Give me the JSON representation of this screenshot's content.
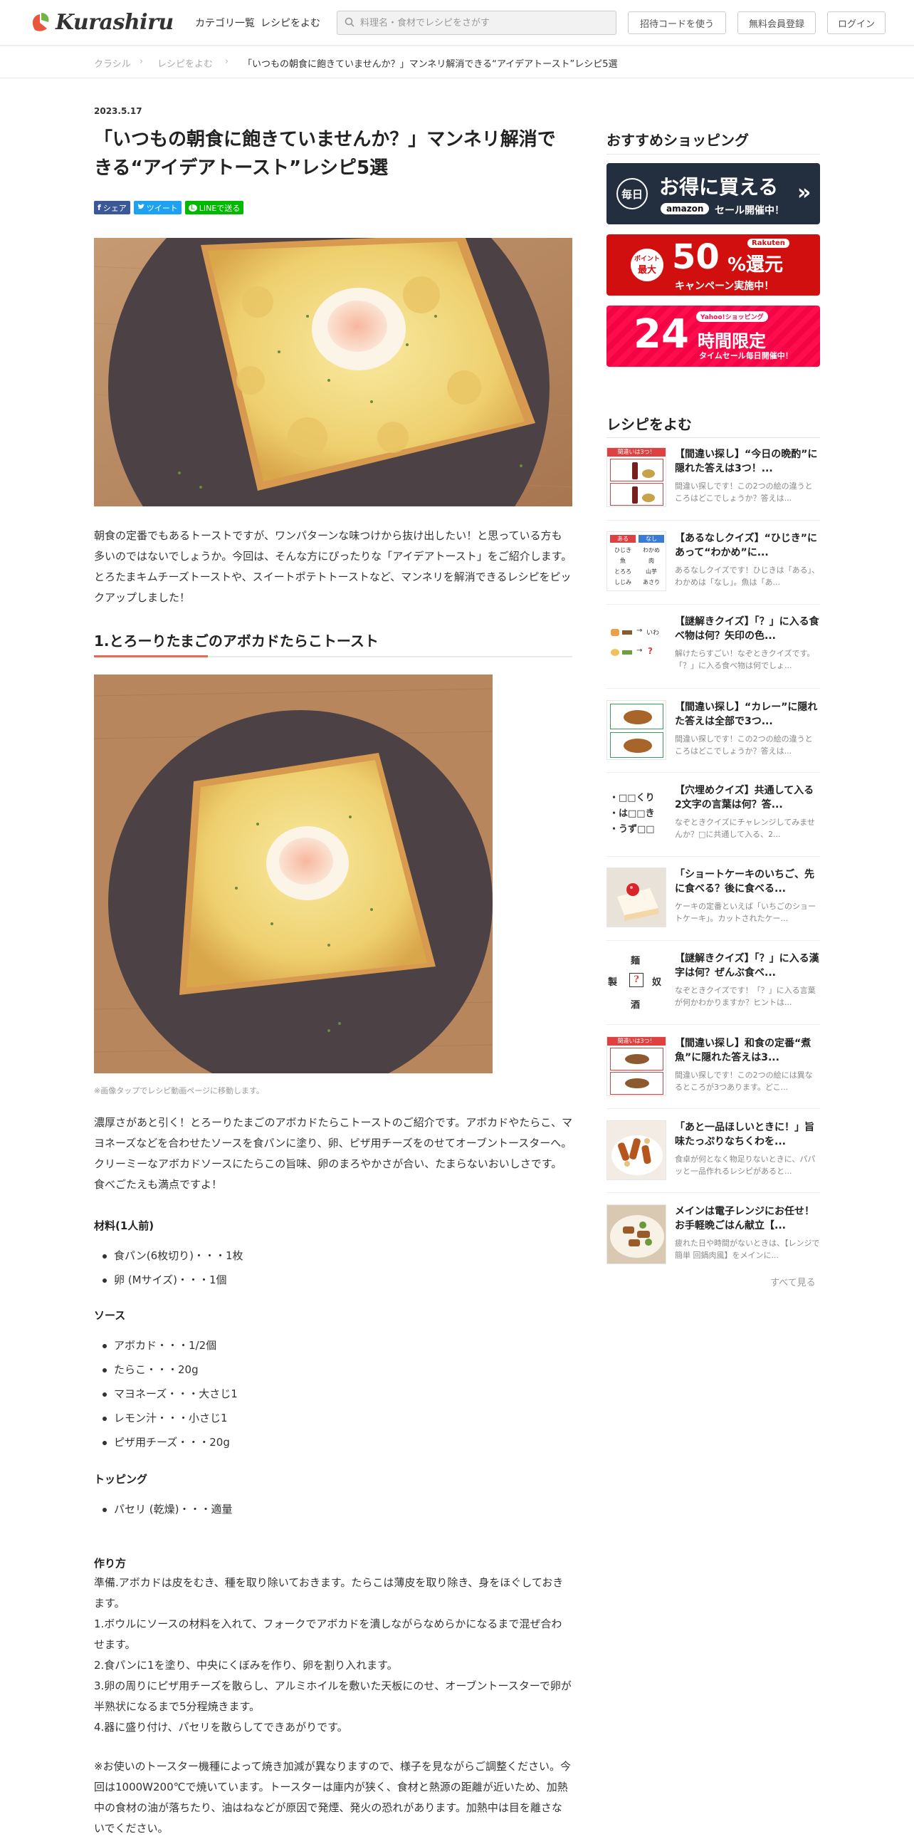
{
  "header": {
    "logo_text": "Kurashiru",
    "nav_category": "カテゴリ一覧",
    "nav_read": "レシピをよむ",
    "search_placeholder": "料理名・食材でレシピをさがす",
    "invite_button": "招待コードを使う",
    "register_button": "無料会員登録",
    "login_button": "ログイン"
  },
  "breadcrumb": {
    "items": [
      "クラシル",
      "レシピをよむ",
      "「いつもの朝食に飽きていませんか？」マンネリ解消できる“アイデアトースト”レシピ5選"
    ]
  },
  "article": {
    "date": "2023.5.17",
    "title": "「いつもの朝食に飽きていませんか？」マンネリ解消できる“アイデアトースト”レシピ5選",
    "share": {
      "facebook": "シェア",
      "twitter": "ツイート",
      "line": "LINEで送る"
    },
    "intro": "朝食の定番でもあるトーストですが、ワンパターンな味つけから抜け出したい！と思っている方も多いのではないでしょうか。今回は、そんな方にぴったりな「アイデアトースト」をご紹介します。とろたまキムチーズトーストや、スイートポテトトーストなど、マンネリを解消できるレシピをピックアップしました！",
    "section1_title": "1.とろーりたまごのアボカドたらこトースト",
    "image_caption": "※画像タップでレシピ動画ページに移動します。",
    "section1_text": "濃厚さがあと引く！とろーりたまごのアボカドたらこトーストのご紹介です。アボカドやたらこ、マヨネーズなどを合わせたソースを食パンに塗り、卵、ピザ用チーズをのせてオーブントースターへ。クリーミーなアボカドソースにたらこの旨味、卵のまろやかさが合い、たまらないおいしさです。食べごたえも満点ですよ！",
    "ingredients_title": "材料(1人前)",
    "ingredients": [
      "食パン(6枚切り)・・・1枚",
      "卵 (Mサイズ)・・・1個"
    ],
    "sauce_title": "ソース",
    "sauce": [
      "アボカド・・・1/2個",
      "たらこ・・・20g",
      "マヨネーズ・・・大さじ1",
      "レモン汁・・・小さじ1",
      "ピザ用チーズ・・・20g"
    ],
    "topping_title": "トッピング",
    "topping": [
      "パセリ (乾燥)・・・適量"
    ],
    "steps_title": "作り方",
    "steps": [
      "準備.アボカドは皮をむき、種を取り除いておきます。たらこは薄皮を取り除き、身をほぐしておきます。",
      "1.ボウルにソースの材料を入れて、フォークでアボカドを潰しながらなめらかになるまで混ぜ合わせます。",
      "2.食パンに1を塗り、中央にくぼみを作り、卵を割り入れます。",
      "3.卵の周りにピザ用チーズを散らし、アルミホイルを敷いた天板にのせ、オーブントースターで卵が半熟状になるまで5分程焼きます。",
      "4.器に盛り付け、パセリを散らしてできあがりです。"
    ],
    "note": "※お使いのトースター機種によって焼き加減が異なりますので、様子を見ながらご調整ください。今回は1000W200℃で焼いています。トースターは庫内が狭く、食材と熱源の距離が近いため、加熱中の食材の油が落ちたり、油はねなどが原因で発煙、発火の恐れがあります。加熱中は目を離さないでください。"
  },
  "sidebar": {
    "shopping_title": "おすすめショッピング",
    "banners": [
      {
        "badge": "毎日",
        "main": "お得に買える",
        "brand": "amazon",
        "sub": "セール開催中！"
      },
      {
        "badge_top": "ポイント",
        "badge_bottom": "最大",
        "num": "50",
        "unit": "%還元",
        "brand": "Rakuten",
        "sub": "キャンペーン実施中！"
      },
      {
        "brand": "Yahoo!ショッピング",
        "num": "24",
        "main": "時間限定",
        "sub": "タイムセール毎日開催中！"
      }
    ],
    "read_title": "レシピをよむ",
    "items": [
      {
        "title": "【間違い探し】“今日の晩酌”に隠れた答えは3つ！...",
        "desc": "間違い探しです！この2つの絵の違うところはどこでしょうか？答えは...",
        "thumb": "spot-diff-drinks",
        "badge": "間違いは3つ！"
      },
      {
        "title": "【あるなしクイズ】“ひじき”にあって“わかめ”に...",
        "desc": "あるなしクイズです！ひじきは「ある」、わかめは「なし」。魚は「あ...",
        "thumb": "aru-nashi",
        "col_a": "ある",
        "col_b": "なし",
        "rows_a": [
          "ひじき",
          "魚",
          "とろろ",
          "しじみ"
        ],
        "rows_b": [
          "わかめ",
          "肉",
          "山芋",
          "あさり"
        ]
      },
      {
        "title": "【謎解きクイズ】「？」に入る食べ物は何？矢印の色...",
        "desc": "解けたらすごい！なぞときクイズです。「？」に入る食べ物は何でしょ...",
        "thumb": "riddle-arrows",
        "arrow_word": "いわ"
      },
      {
        "title": "【間違い探し】“カレー”に隠れた答えは全部で3つ...",
        "desc": "間違い探しです！この2つの絵の違うところはどこでしょうか？答えは...",
        "thumb": "spot-diff-curry"
      },
      {
        "title": "【穴埋めクイズ】共通して入る2文字の言葉は何？答...",
        "desc": "なぞときクイズにチャレンジしてみませんか？□に共通して入る、2...",
        "thumb": "fill-blank",
        "lines": [
          "・□□くり",
          "・は□□き",
          "・うず□□"
        ]
      },
      {
        "title": "「ショートケーキのいちご、先に食べる？後に食べる...",
        "desc": "ケーキの定番といえば「いちごのショートケーキ」。カットされたケー...",
        "thumb": "shortcake"
      },
      {
        "title": "【謎解きクイズ】「？」に入る漢字は何？ぜんぶ食べ...",
        "desc": "なぞときクイズです！「？」に入る言葉が何かわかりますか？ヒントは...",
        "thumb": "kanji-puzzle",
        "kanji": [
          "麺",
          "製",
          "奴",
          "酒",
          "?"
        ]
      },
      {
        "title": "【間違い探し】和食の定番“煮魚”に隠れた答えは3...",
        "desc": "間違い探しです！この2つの絵には異なるところが3つあります。どこ...",
        "thumb": "spot-diff-fish",
        "badge": "間違いは3つ！"
      },
      {
        "title": "「あと一品ほしいときに！」旨味たっぷりなちくわを...",
        "desc": "食卓が何となく物足りないときに、パパッと一品作れるレシピがあると...",
        "thumb": "chikuwa"
      },
      {
        "title": "メインは電子レンジにお任せ！お手軽晩ごはん献立【...",
        "desc": "疲れた日や時間がないときは、【レンジで簡単 回鍋肉風】をメインに...",
        "thumb": "bento"
      }
    ],
    "see_all": "すべて見る"
  },
  "colors": {
    "accent": "#e56a54",
    "logo_red": "#e8573c",
    "logo_green": "#74b447"
  }
}
